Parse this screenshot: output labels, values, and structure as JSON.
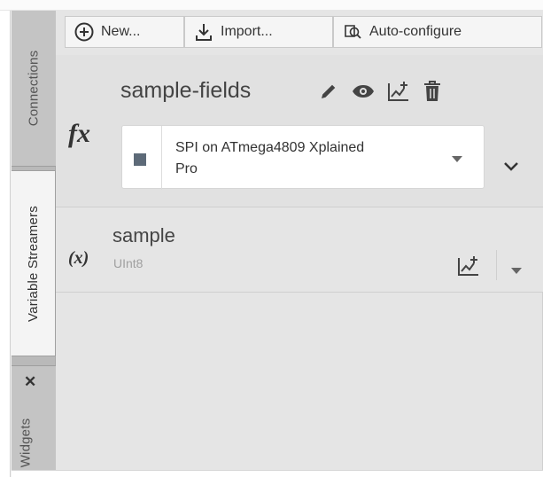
{
  "vertical_tabs": {
    "connections": "Connections",
    "variable_streamers": "Variable Streamers",
    "widgets": "Widgets",
    "close_glyph": "✕"
  },
  "toolbar": {
    "new_label": "New...",
    "import_label": "Import...",
    "auto_configure_label": "Auto-configure"
  },
  "stream": {
    "name": "sample-fields",
    "icon_text": "fx",
    "connection": {
      "line1": "SPI on ATmega4809 Xplained",
      "line2": "Pro",
      "color": "#5d6a78"
    },
    "actions": [
      "edit-icon",
      "eye-icon",
      "chart-add-icon",
      "trash-icon"
    ]
  },
  "variable": {
    "icon_text": "(x)",
    "name": "sample",
    "type": "UInt8"
  },
  "colors": {
    "accent_icon": "#444444",
    "panel_bg": "#e5e5e5",
    "tab_strip": "#b9b9b9"
  }
}
